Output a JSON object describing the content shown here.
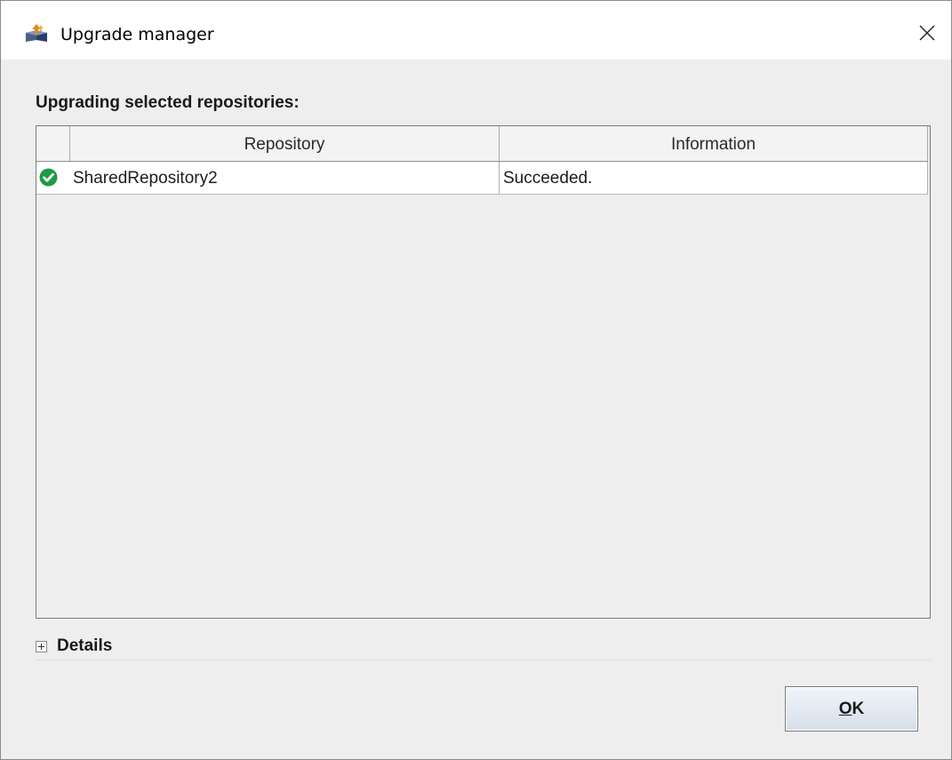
{
  "window": {
    "title": "Upgrade manager",
    "app_icon": "upgrade-manager-icon",
    "close_icon": "close-icon"
  },
  "heading": "Upgrading selected repositories:",
  "table": {
    "columns": [
      "",
      "Repository",
      "Information"
    ],
    "rows": [
      {
        "status_icon": "success-check-icon",
        "status_color": "#1e9b44",
        "repository": "SharedRepository2",
        "information": "Succeeded."
      }
    ]
  },
  "details": {
    "label": "Details",
    "expand_icon": "plus-box-icon"
  },
  "buttons": {
    "ok_mnemonic": "O",
    "ok_rest": "K"
  }
}
